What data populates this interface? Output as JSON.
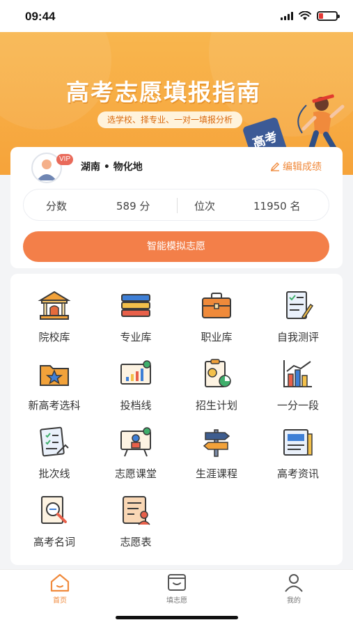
{
  "status_bar": {
    "time": "09:44"
  },
  "banner": {
    "title": "高考志愿填报指南",
    "subtitle": "选学校、择专业、一对一填报分析",
    "tag": "高考"
  },
  "profile": {
    "vip_label": "VIP",
    "region": "湖南 • 物化地",
    "edit_label": "编辑成绩"
  },
  "score": {
    "score_label": "分数",
    "score_value": "589 分",
    "rank_label": "位次",
    "rank_value": "11950 名"
  },
  "simulate_button": "智能模拟志愿",
  "features": [
    {
      "label": "院校库",
      "icon": "university-icon"
    },
    {
      "label": "专业库",
      "icon": "books-icon"
    },
    {
      "label": "职业库",
      "icon": "briefcase-icon"
    },
    {
      "label": "自我测评",
      "icon": "assessment-icon"
    },
    {
      "label": "新高考选科",
      "icon": "star-folder-icon"
    },
    {
      "label": "投档线",
      "icon": "bar-chart-board-icon"
    },
    {
      "label": "招生计划",
      "icon": "plan-clipboard-icon"
    },
    {
      "label": "一分一段",
      "icon": "trend-chart-icon"
    },
    {
      "label": "批次线",
      "icon": "checklist-icon"
    },
    {
      "label": "志愿课堂",
      "icon": "classroom-board-icon"
    },
    {
      "label": "生涯课程",
      "icon": "signpost-icon"
    },
    {
      "label": "高考资讯",
      "icon": "news-icon"
    },
    {
      "label": "高考名词",
      "icon": "dictionary-search-icon"
    },
    {
      "label": "志愿表",
      "icon": "form-user-icon"
    }
  ],
  "tabs": [
    {
      "label": "首页",
      "icon": "home-icon",
      "active": true
    },
    {
      "label": "填志愿",
      "icon": "fill-form-icon",
      "active": false
    },
    {
      "label": "我的",
      "icon": "user-icon",
      "active": false
    }
  ],
  "colors": {
    "primary": "#f37f49",
    "accent": "#f08a3c",
    "banner": "#f6a33a"
  }
}
